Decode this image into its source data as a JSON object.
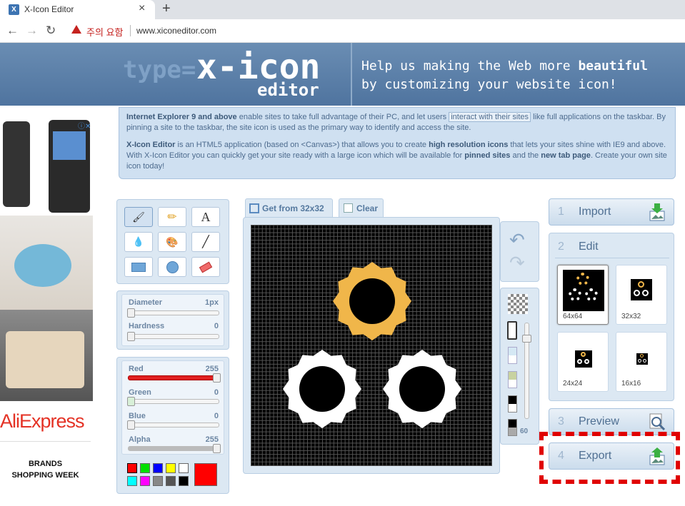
{
  "browser": {
    "tab_title": "X-Icon Editor",
    "favicon_letter": "X",
    "close_glyph": "×",
    "newtab_glyph": "+",
    "back_glyph": "←",
    "forward_glyph": "→",
    "reload_glyph": "↻",
    "warning_text": "주의 요함",
    "url": "www.xiconeditor.com"
  },
  "header": {
    "logo_type": "type=",
    "logo_name": "x-icon",
    "logo_sub": "editor",
    "tagline_pre": "Help us making the Web more ",
    "tagline_bold": "beautiful",
    "tagline_post": "by customizing your website icon!"
  },
  "info": {
    "p1_bold": "Internet Explorer 9 and above",
    "p1_a": " enable sites to take full advantage of their PC, and let users ",
    "p1_hl": "interact with their sites",
    "p1_b": " like full applications on the taskbar. By pinning a site to the taskbar, the site icon is used as the primary way to identify and access the site.",
    "p2_bold1": "X-Icon Editor",
    "p2_a": " is an HTML5 application (based on <Canvas>) that allows you to create ",
    "p2_bold2": "high resolution icons",
    "p2_b": " that lets your sites shine with IE9 and above. With X-Icon Editor you can quickly get your site ready with a large icon which will be available for ",
    "p2_bold3": "pinned sites",
    "p2_c": " and the ",
    "p2_bold4": "new tab page",
    "p2_d": ". Create your own site icon today!"
  },
  "ads": {
    "adchoices": "ⓘ✕",
    "aliexpress": "AliExpress",
    "brands_line1": "BRANDS",
    "brands_line2": "SHOPPING WEEK"
  },
  "tools": {
    "items": [
      {
        "name": "brush-icon",
        "glyph": "🖌"
      },
      {
        "name": "pencil-icon",
        "glyph": "✏"
      },
      {
        "name": "text-icon",
        "glyph": "A"
      },
      {
        "name": "eyedropper-icon",
        "glyph": "💧"
      },
      {
        "name": "palette-icon",
        "glyph": "🎨"
      },
      {
        "name": "line-icon",
        "glyph": "╱"
      },
      {
        "name": "rectangle-icon",
        "glyph": ""
      },
      {
        "name": "circle-icon",
        "glyph": ""
      },
      {
        "name": "eraser-icon",
        "glyph": ""
      }
    ]
  },
  "brush": {
    "diameter_label": "Diameter",
    "diameter_value": "1px",
    "hardness_label": "Hardness",
    "hardness_value": "0"
  },
  "color": {
    "red_label": "Red",
    "red_value": "255",
    "green_label": "Green",
    "green_value": "0",
    "blue_label": "Blue",
    "blue_value": "0",
    "alpha_label": "Alpha",
    "alpha_value": "255",
    "current": "#ff0000",
    "swatches": [
      "#ff0000",
      "#00e000",
      "#0000ff",
      "#ffff00",
      "#ffffff",
      "#00ffff",
      "#ff00ff",
      "#888888",
      "#555555",
      "#000000"
    ]
  },
  "canvas": {
    "get_label": "Get from 32x32",
    "clear_label": "Clear",
    "zoom_value": "60"
  },
  "steps": {
    "import_num": "1",
    "import_label": "Import",
    "edit_num": "2",
    "edit_label": "Edit",
    "preview_num": "3",
    "preview_label": "Preview",
    "export_num": "4",
    "export_label": "Export"
  },
  "sizes": [
    "64x64",
    "32x32",
    "24x24",
    "16x16"
  ],
  "colors": {
    "gear_gold": "#f0b64a",
    "gear_white": "#ffffff",
    "highlight": "#e00000"
  }
}
